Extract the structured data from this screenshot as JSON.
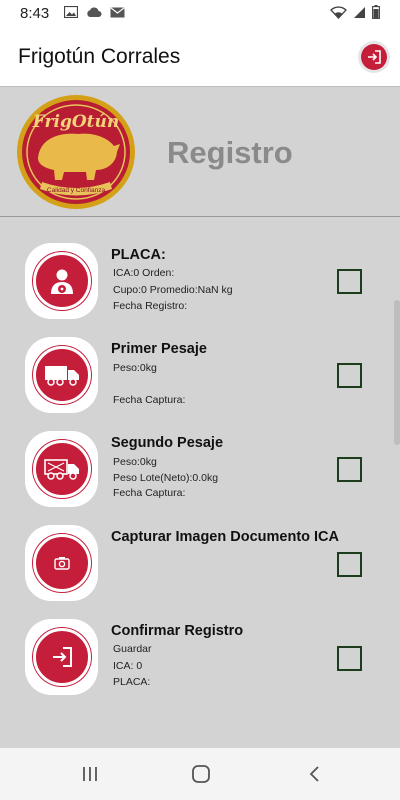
{
  "status_bar": {
    "time": "8:43",
    "left_icons": [
      "image-icon",
      "cloud-icon",
      "mail-icon"
    ],
    "right_icons": [
      "wifi-icon",
      "signal-icon",
      "battery-icon"
    ]
  },
  "app_bar": {
    "title": "Frigotún Corrales",
    "exit_icon": "exit-icon"
  },
  "header": {
    "logo_text": "FrigOtún",
    "logo_tagline": "Calidad y Confianza",
    "title": "Registro"
  },
  "steps": [
    {
      "title": "PLACA:",
      "icon": "driver-icon",
      "lines": [
        "ICA:0 Orden:",
        "Cupo:0 Promedio:NaN kg",
        "Fecha Registro:"
      ],
      "checked": false
    },
    {
      "title": "Primer Pesaje",
      "icon": "truck-icon",
      "lines": [
        "Peso:0kg",
        "",
        "Fecha Captura:"
      ],
      "checked": false
    },
    {
      "title": "Segundo Pesaje",
      "icon": "loaded-truck-icon",
      "lines": [
        "Peso:0kg",
        "Peso Lote(Neto):0.0kg",
        "Fecha Captura:"
      ],
      "checked": false
    },
    {
      "title": "Capturar Imagen Documento ICA",
      "icon": "camera-icon",
      "lines": [],
      "checked": false
    },
    {
      "title": "Confirmar Registro",
      "icon": "login-icon",
      "lines": [
        "Guardar",
        "ICA: 0",
        "PLACA:"
      ],
      "checked": false
    }
  ],
  "nav_bar": {
    "buttons": [
      "recent-apps-icon",
      "home-icon",
      "back-icon"
    ]
  },
  "colors": {
    "accent": "#c41e3a",
    "background": "#d3d3d3",
    "checkbox_border": "#1c3d1c",
    "header_title": "#8a8a8a"
  }
}
